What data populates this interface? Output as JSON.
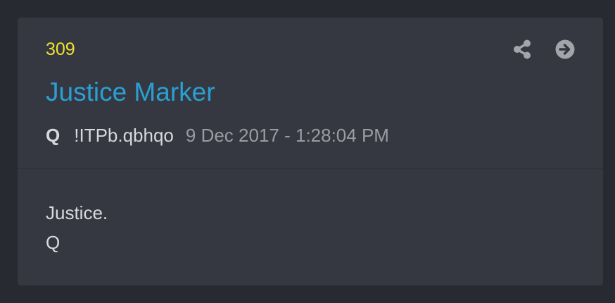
{
  "post": {
    "number": "309",
    "title": "Justice Marker",
    "author": "Q",
    "tripcode": "!ITPb.qbhqo",
    "timestamp": "9 Dec 2017 - 1:28:04 PM",
    "body_lines": [
      "Justice.",
      "Q"
    ]
  },
  "actions": {
    "share_icon": "share-icon",
    "open_icon": "arrow-circle-right-icon"
  },
  "colors": {
    "background": "#272a31",
    "card": "#353841",
    "post_number": "#f0e130",
    "title": "#2b9fd3",
    "text": "#d6d8dd",
    "muted": "#9a9ca3"
  }
}
